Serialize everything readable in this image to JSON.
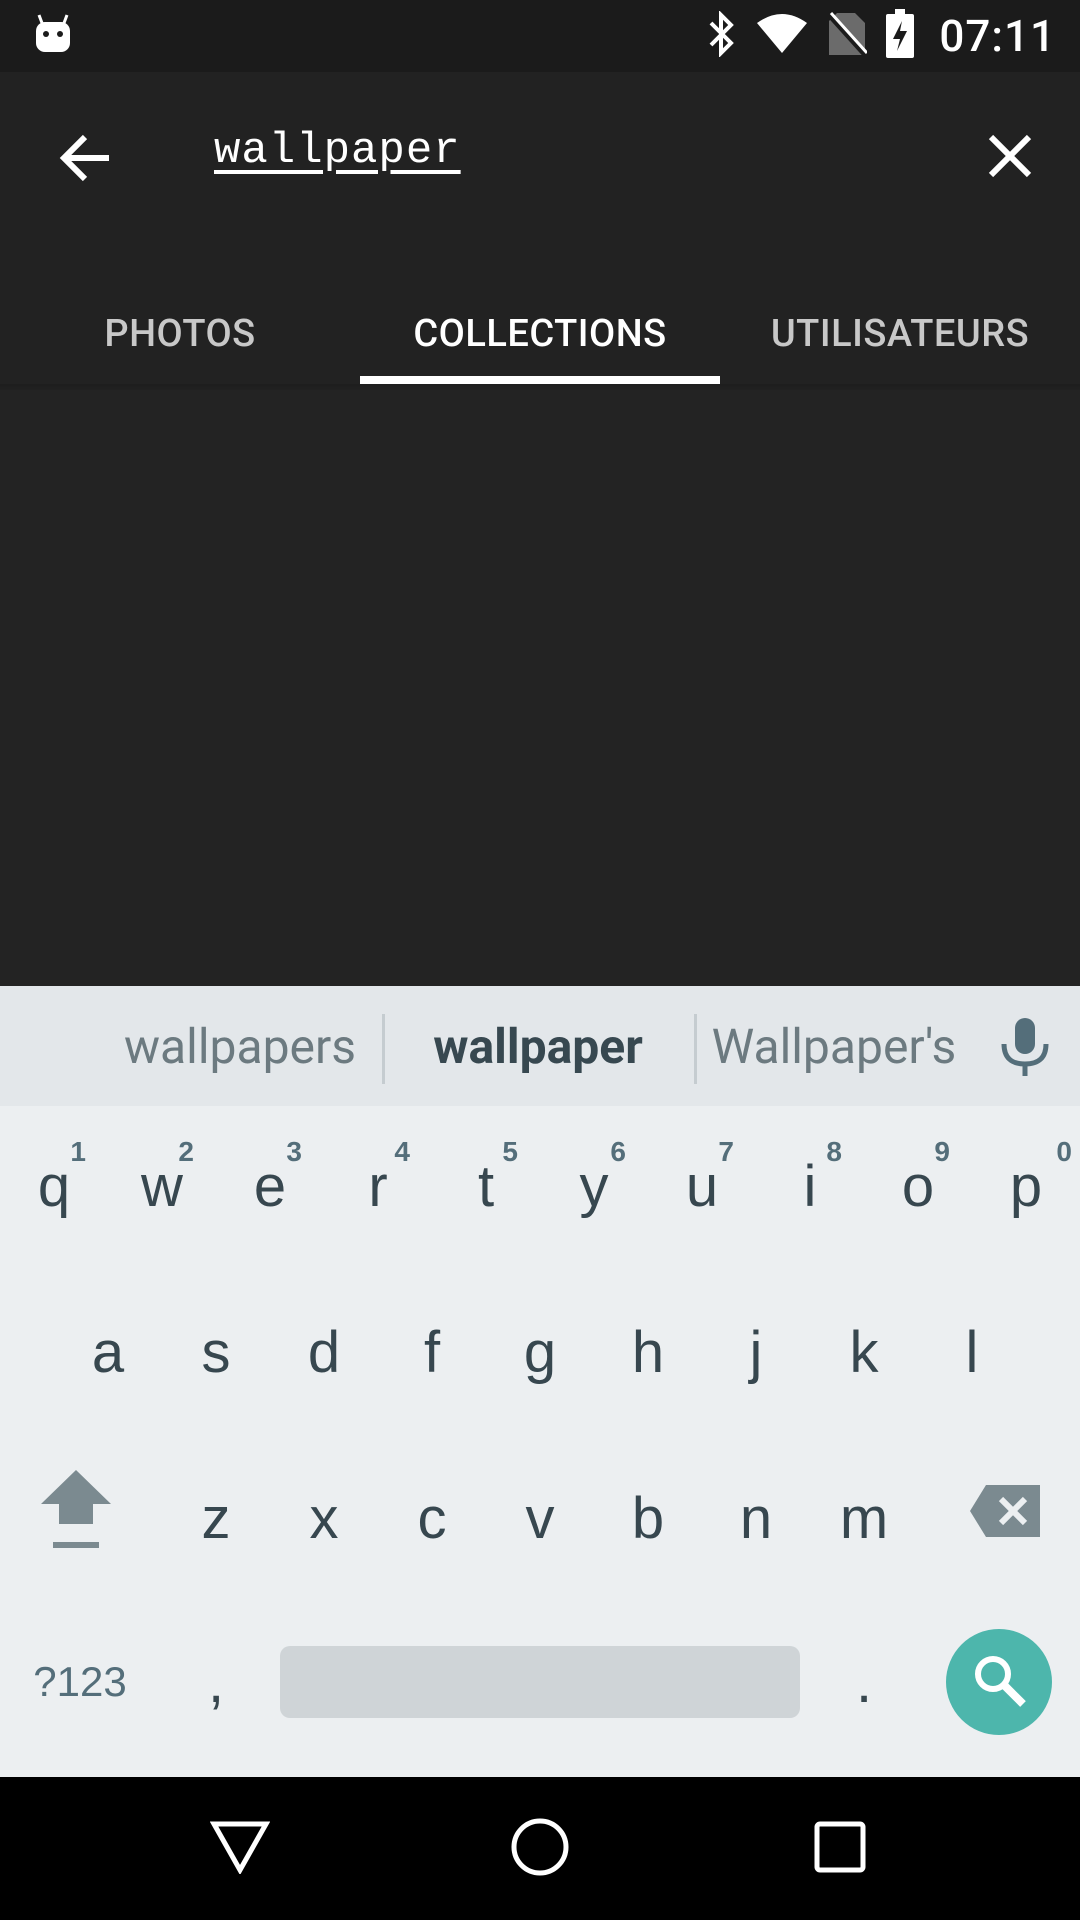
{
  "status_bar": {
    "time": "07:11",
    "icons": [
      "android-notification-icon",
      "bluetooth-icon",
      "wifi-icon",
      "no-sim-icon",
      "battery-charging-icon"
    ]
  },
  "search": {
    "query": "wallpaper"
  },
  "tabs": [
    {
      "label": "PHOTOS",
      "active": false
    },
    {
      "label": "COLLECTIONS",
      "active": true
    },
    {
      "label": "UTILISATEURS",
      "active": false
    }
  ],
  "keyboard": {
    "suggestions": [
      "wallpapers",
      "wallpaper",
      "Wallpaper's"
    ],
    "row1": [
      {
        "key": "q",
        "hint": "1"
      },
      {
        "key": "w",
        "hint": "2"
      },
      {
        "key": "e",
        "hint": "3"
      },
      {
        "key": "r",
        "hint": "4"
      },
      {
        "key": "t",
        "hint": "5"
      },
      {
        "key": "y",
        "hint": "6"
      },
      {
        "key": "u",
        "hint": "7"
      },
      {
        "key": "i",
        "hint": "8"
      },
      {
        "key": "o",
        "hint": "9"
      },
      {
        "key": "p",
        "hint": "0"
      }
    ],
    "row2": [
      "a",
      "s",
      "d",
      "f",
      "g",
      "h",
      "j",
      "k",
      "l"
    ],
    "row3": [
      "z",
      "x",
      "c",
      "v",
      "b",
      "n",
      "m"
    ],
    "symbols_label": "?123",
    "comma": ",",
    "period": "."
  },
  "colors": {
    "app_background": "#232323",
    "tab_indicator": "#ffffff",
    "keyboard_background": "#eceff1",
    "search_key": "#4db6ac"
  }
}
